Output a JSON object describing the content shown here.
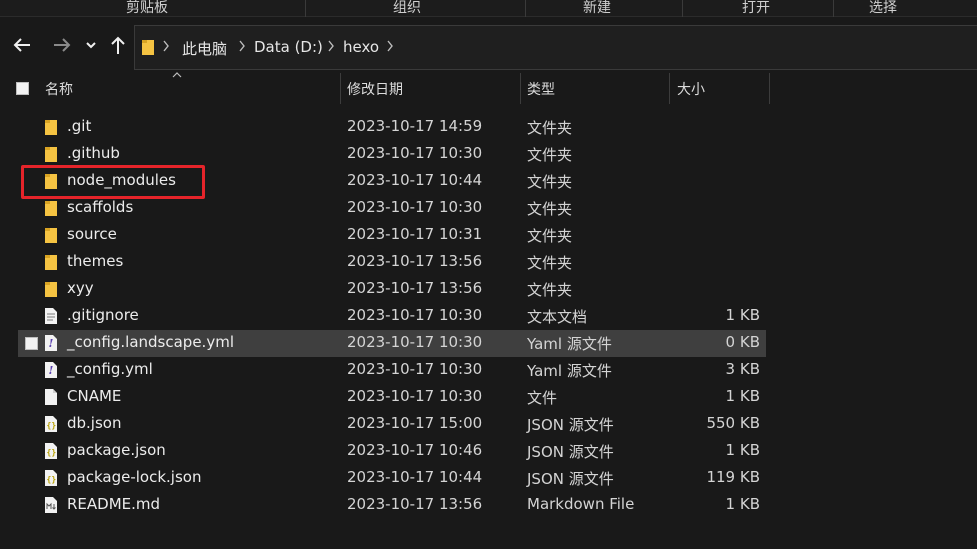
{
  "ribbon": {
    "groups": [
      "剪贴板",
      "组织",
      "新建",
      "打开",
      "选择"
    ]
  },
  "nav": {
    "back_icon": "arrow-left-icon",
    "forward_icon": "arrow-right-icon",
    "recent_icon": "chevron-down-icon",
    "up_icon": "arrow-up-icon",
    "breadcrumb": [
      "此电脑",
      "Data (D:)",
      "hexo"
    ]
  },
  "columns": {
    "name": "名称",
    "date": "修改日期",
    "type": "类型",
    "size": "大小"
  },
  "files": [
    {
      "name": ".git",
      "date": "2023-10-17 14:59",
      "type": "文件夹",
      "size": "",
      "icon": "folder-icon"
    },
    {
      "name": ".github",
      "date": "2023-10-17 10:30",
      "type": "文件夹",
      "size": "",
      "icon": "folder-icon"
    },
    {
      "name": "node_modules",
      "date": "2023-10-17 10:44",
      "type": "文件夹",
      "size": "",
      "icon": "folder-icon"
    },
    {
      "name": "scaffolds",
      "date": "2023-10-17 10:30",
      "type": "文件夹",
      "size": "",
      "icon": "folder-icon"
    },
    {
      "name": "source",
      "date": "2023-10-17 10:31",
      "type": "文件夹",
      "size": "",
      "icon": "folder-icon"
    },
    {
      "name": "themes",
      "date": "2023-10-17 13:56",
      "type": "文件夹",
      "size": "",
      "icon": "folder-icon"
    },
    {
      "name": "xyy",
      "date": "2023-10-17 13:56",
      "type": "文件夹",
      "size": "",
      "icon": "folder-icon"
    },
    {
      "name": ".gitignore",
      "date": "2023-10-17 10:30",
      "type": "文本文档",
      "size": "1 KB",
      "icon": "text-file-icon"
    },
    {
      "name": "_config.landscape.yml",
      "date": "2023-10-17 10:30",
      "type": "Yaml 源文件",
      "size": "0 KB",
      "icon": "yaml-file-icon",
      "selected": true
    },
    {
      "name": "_config.yml",
      "date": "2023-10-17 10:30",
      "type": "Yaml 源文件",
      "size": "3 KB",
      "icon": "yaml-file-icon"
    },
    {
      "name": "CNAME",
      "date": "2023-10-17 10:30",
      "type": "文件",
      "size": "1 KB",
      "icon": "blank-file-icon"
    },
    {
      "name": "db.json",
      "date": "2023-10-17 15:00",
      "type": "JSON 源文件",
      "size": "550 KB",
      "icon": "json-file-icon"
    },
    {
      "name": "package.json",
      "date": "2023-10-17 10:46",
      "type": "JSON 源文件",
      "size": "1 KB",
      "icon": "json-file-icon"
    },
    {
      "name": "package-lock.json",
      "date": "2023-10-17 10:44",
      "type": "JSON 源文件",
      "size": "119 KB",
      "icon": "json-file-icon"
    },
    {
      "name": "README.md",
      "date": "2023-10-17 13:56",
      "type": "Markdown File",
      "size": "1 KB",
      "icon": "markdown-file-icon"
    }
  ],
  "colors": {
    "background": "#191919",
    "selected_row": "#3f3f3f",
    "highlight_box": "#e5242a",
    "folder": "#f5c342"
  }
}
